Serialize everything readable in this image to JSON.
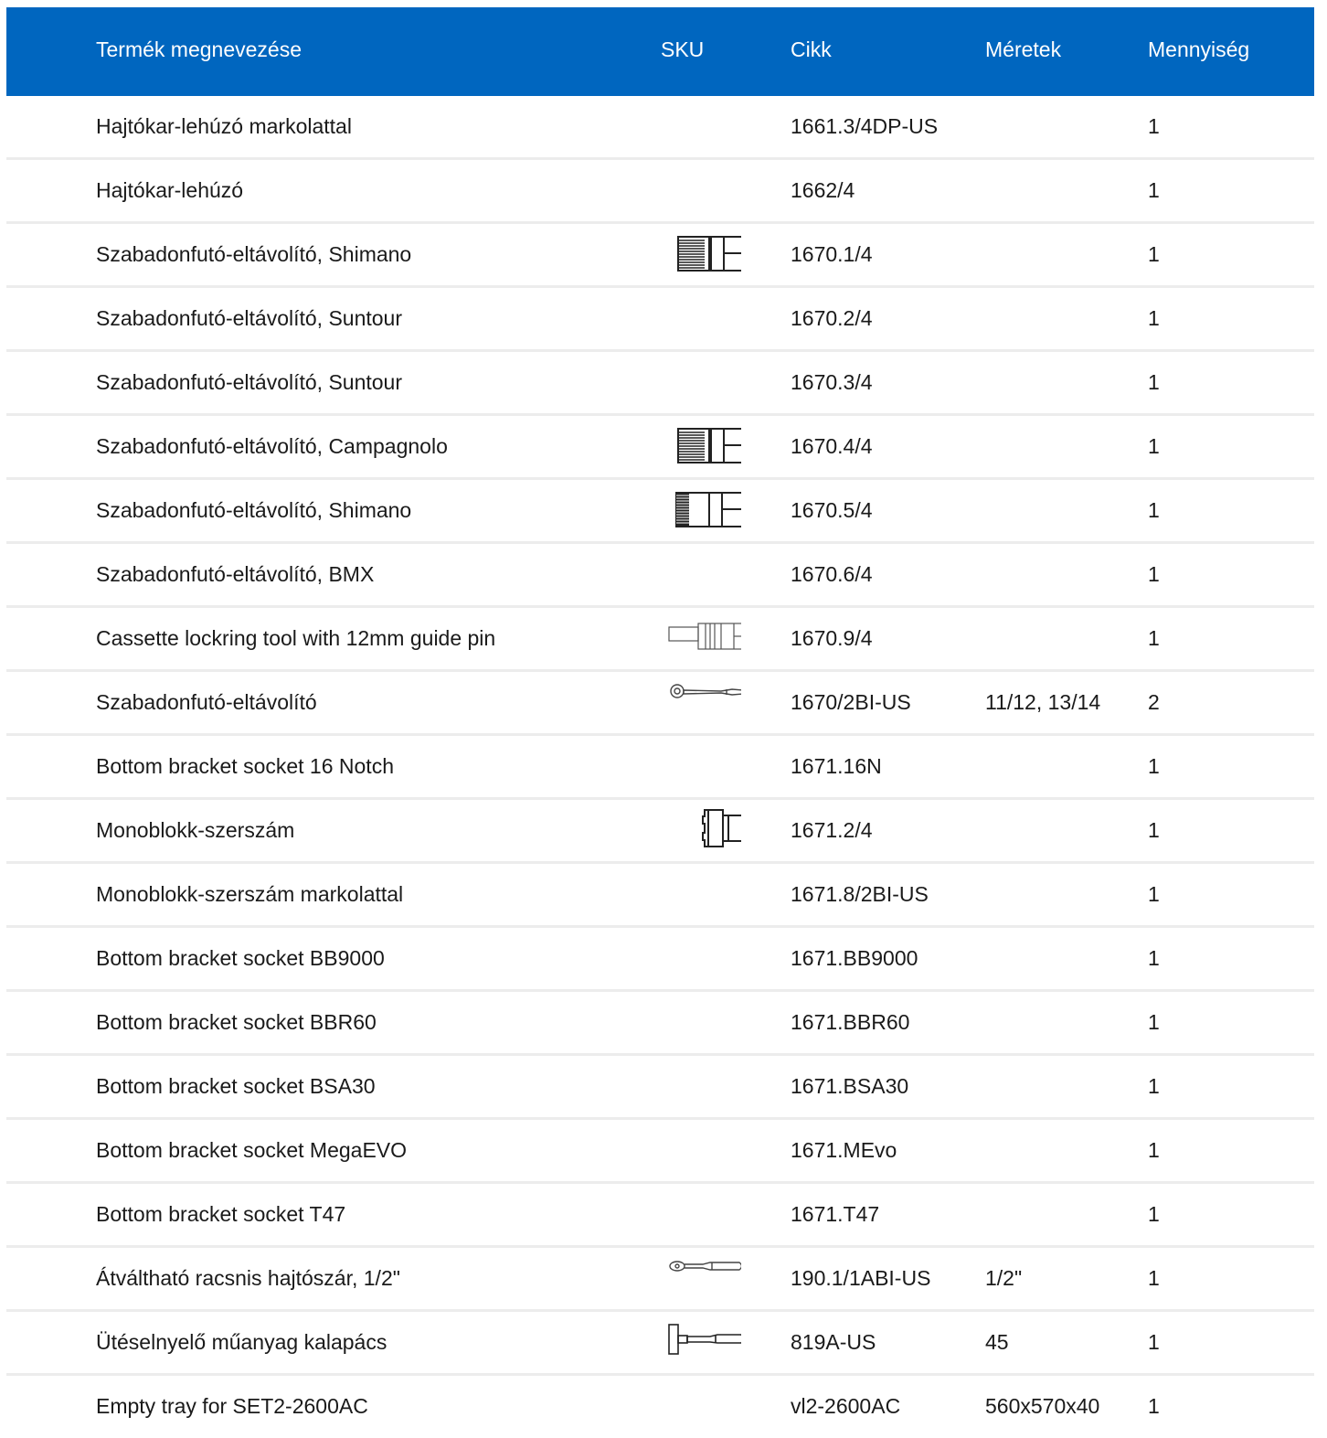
{
  "header": {
    "name": "Termék megnevezése",
    "sku": "SKU",
    "cikk": "Cikk",
    "size": "Méretek",
    "qty": "Mennyiség"
  },
  "rows": [
    {
      "name": "Hajtókar-lehúzó markolattal",
      "cikk": "1661.3/4DP-US",
      "size": "",
      "qty": "1",
      "icon": ""
    },
    {
      "name": "Hajtókar-lehúzó",
      "cikk": "1662/4",
      "size": "",
      "qty": "1",
      "icon": ""
    },
    {
      "name": "Szabadonfutó-eltávolító, Shimano",
      "cikk": "1670.1/4",
      "size": "",
      "qty": "1",
      "icon": "freewheel-tool-icon"
    },
    {
      "name": "Szabadonfutó-eltávolító, Suntour",
      "cikk": "1670.2/4",
      "size": "",
      "qty": "1",
      "icon": ""
    },
    {
      "name": "Szabadonfutó-eltávolító, Suntour",
      "cikk": "1670.3/4",
      "size": "",
      "qty": "1",
      "icon": ""
    },
    {
      "name": "Szabadonfutó-eltávolító, Campagnolo",
      "cikk": "1670.4/4",
      "size": "",
      "qty": "1",
      "icon": "freewheel-tool-icon"
    },
    {
      "name": "Szabadonfutó-eltávolító, Shimano",
      "cikk": "1670.5/4",
      "size": "",
      "qty": "1",
      "icon": "freewheel-tool-dense-icon"
    },
    {
      "name": "Szabadonfutó-eltávolító, BMX",
      "cikk": "1670.6/4",
      "size": "",
      "qty": "1",
      "icon": ""
    },
    {
      "name": "Cassette lockring tool with 12mm guide pin",
      "cikk": "1670.9/4",
      "size": "",
      "qty": "1",
      "icon": "lockring-tool-icon"
    },
    {
      "name": "Szabadonfutó-eltávolító",
      "cikk": "1670/2BI-US",
      "size": "11/12, 13/14",
      "qty": "2",
      "icon": "wrench-icon"
    },
    {
      "name": "Bottom bracket socket 16 Notch",
      "cikk": "1671.16N",
      "size": "",
      "qty": "1",
      "icon": ""
    },
    {
      "name": "Monoblokk-szerszám",
      "cikk": "1671.2/4",
      "size": "",
      "qty": "1",
      "icon": "monoblock-tool-icon"
    },
    {
      "name": "Monoblokk-szerszám markolattal",
      "cikk": "1671.8/2BI-US",
      "size": "",
      "qty": "1",
      "icon": ""
    },
    {
      "name": "Bottom bracket socket BB9000",
      "cikk": "1671.BB9000",
      "size": "",
      "qty": "1",
      "icon": ""
    },
    {
      "name": "Bottom bracket socket BBR60",
      "cikk": "1671.BBR60",
      "size": "",
      "qty": "1",
      "icon": ""
    },
    {
      "name": "Bottom bracket socket BSA30",
      "cikk": "1671.BSA30",
      "size": "",
      "qty": "1",
      "icon": ""
    },
    {
      "name": "Bottom bracket socket MegaEVO",
      "cikk": "1671.MEvo",
      "size": "",
      "qty": "1",
      "icon": ""
    },
    {
      "name": "Bottom bracket socket T47",
      "cikk": "1671.T47",
      "size": "",
      "qty": "1",
      "icon": ""
    },
    {
      "name": "Átváltható racsnis hajtószár, 1/2\"",
      "cikk": "190.1/1ABI-US",
      "size": "1/2\"",
      "qty": "1",
      "icon": "ratchet-icon"
    },
    {
      "name": "Ütéselnyelő műanyag kalapács",
      "cikk": "819A-US",
      "size": "45",
      "qty": "1",
      "icon": "hammer-icon"
    },
    {
      "name": "Empty tray for SET2-2600AC",
      "cikk": "vl2-2600AC",
      "size": "560x570x40",
      "qty": "1",
      "icon": ""
    }
  ]
}
